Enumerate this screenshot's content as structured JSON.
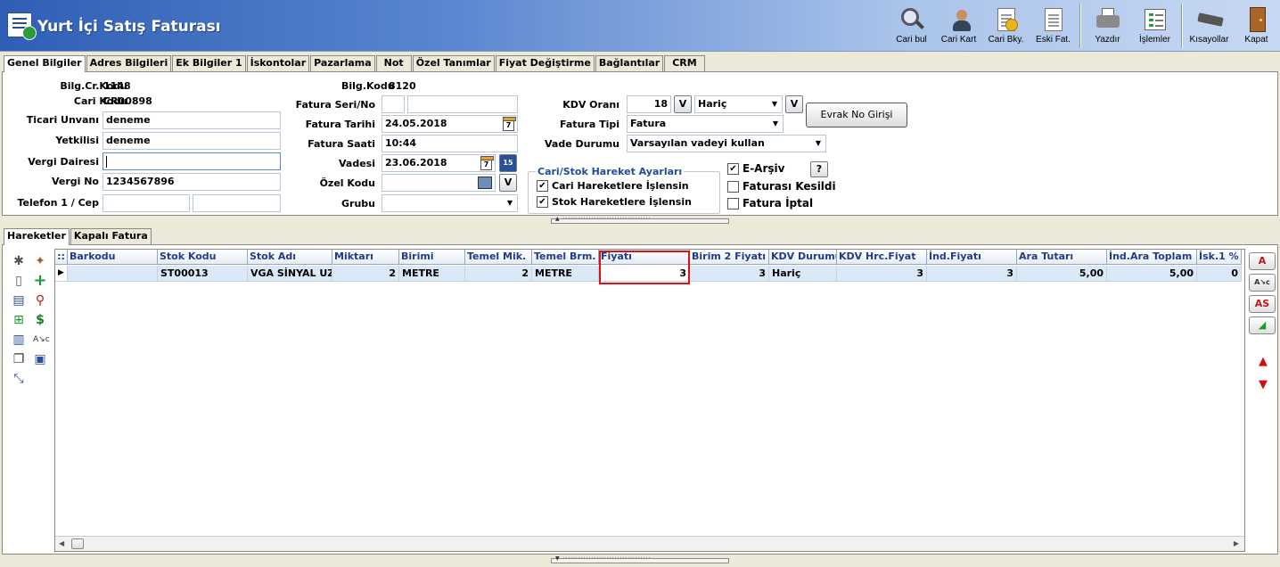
{
  "window": {
    "title": "Yurt İçi Satış Faturası"
  },
  "toolbar": [
    {
      "label": "Cari bul",
      "icon": "search-person-icon"
    },
    {
      "label": "Cari Kart",
      "icon": "person-card-icon"
    },
    {
      "label": "Cari Bky.",
      "icon": "balance-doc-icon"
    },
    {
      "label": "Eski Fat.",
      "icon": "old-invoice-icon"
    },
    {
      "label": "Yazdır",
      "icon": "printer-icon"
    },
    {
      "label": "İşlemler",
      "icon": "operations-icon"
    },
    {
      "label": "Kısayollar",
      "icon": "keyboard-icon"
    },
    {
      "label": "Kapat",
      "icon": "exit-door-icon"
    }
  ],
  "tabs_top": [
    "Genel Bilgiler",
    "Adres Bilgileri",
    "Ek Bilgiler 1",
    "İskontolar",
    "Pazarlama",
    "Not",
    "Özel Tanımlar",
    "Fiyat Değiştirme",
    "Bağlantılar",
    "CRM"
  ],
  "form": {
    "bilg_cr_kodu_label": "Bilg.Cr.Kodu",
    "bilg_cr_kodu": "1148",
    "cari_kodu_label": "Cari Kodu",
    "cari_kodu": "CR00898",
    "ticari_unvani_label": "Ticari Unvanı",
    "ticari_unvani": "deneme",
    "yetkilisi_label": "Yetkilisi",
    "yetkilisi": "deneme",
    "vergi_dairesi_label": "Vergi Dairesi",
    "vergi_dairesi": "",
    "vergi_no_label": "Vergi No",
    "vergi_no": "1234567896",
    "telefon_label": "Telefon 1 / Cep",
    "telefon1": "",
    "cep": "",
    "bilg_kodu_label": "Bilg.Kodu",
    "bilg_kodu": "8120",
    "fatura_seri_no_label": "Fatura Seri/No",
    "fatura_seri": "",
    "fatura_no": "",
    "fatura_tarihi_label": "Fatura Tarihi",
    "fatura_tarihi": "24.05.2018",
    "fatura_saati_label": "Fatura Saati",
    "fatura_saati": "10:44",
    "vadesi_label": "Vadesi",
    "vadesi": "23.06.2018",
    "ozel_kodu_label": "Özel Kodu",
    "ozel_kodu": "",
    "grubu_label": "Grubu",
    "grubu": "",
    "kdv_orani_label": "KDV Oranı",
    "kdv_orani": "18",
    "kdv_tipi": "Hariç",
    "fatura_tipi_label": "Fatura Tipi",
    "fatura_tipi": "Fatura",
    "vade_durumu_label": "Vade Durumu",
    "vade_durumu": "Varsayılan vadeyi kullan",
    "v_button": "V",
    "evrak_no_button": "Evrak No Girişi",
    "calendar_day": "7",
    "calendar2_day": "15",
    "help_button": "?"
  },
  "hareket_ayarlari": {
    "title": "Cari/Stok Hareket Ayarları",
    "cari": {
      "label": "Cari Hareketlere İşlensin",
      "checked": true
    },
    "stok": {
      "label": "Stok Hareketlere İşlensin",
      "checked": true
    }
  },
  "flags": {
    "e_arsiv": {
      "label": "E-Arşiv",
      "checked": true
    },
    "faturasi_kesildi": {
      "label": "Faturası Kesildi",
      "checked": false
    },
    "fatura_iptal": {
      "label": "Fatura İptal",
      "checked": false
    }
  },
  "tabs_bottom": [
    "Hareketler",
    "Kapalı Fatura"
  ],
  "grid": {
    "columns": [
      "Barkodu",
      "Stok Kodu",
      "Stok Adı",
      "Miktarı",
      "Birimi",
      "Temel Mik.",
      "Temel Brm.",
      "Fiyatı",
      "Birim 2 Fiyatı",
      "KDV Durumu",
      "KDV Hrc.Fiyat",
      "İnd.Fiyatı",
      "Ara Tutarı",
      "İnd.Ara Toplam",
      "İsk.1 %"
    ],
    "rows": [
      [
        "",
        "ST00013",
        "VGA SİNYAL UZA",
        "2",
        "METRE",
        "2",
        "METRE",
        "3",
        "3",
        "Hariç",
        "3",
        "3",
        "5,00",
        "5,00",
        "0"
      ]
    ]
  },
  "right_tools": {
    "a": "A",
    "as": "AS"
  },
  "colors": {
    "title_gradient_start": "#2f5fb5",
    "header_text": "#1f3d8a",
    "highlight": "#e01010",
    "selected_row": "#dbe8f7"
  }
}
